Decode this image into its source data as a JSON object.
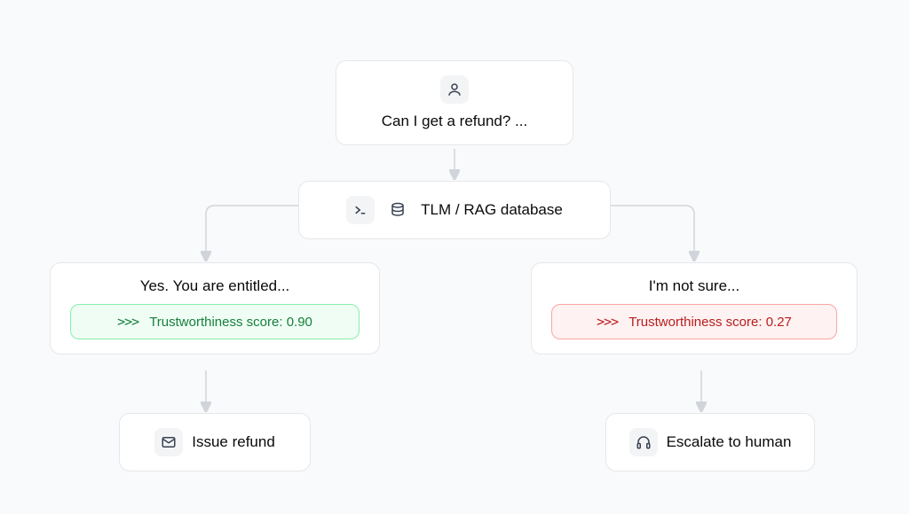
{
  "user_node": {
    "text": "Can I get a refund? ..."
  },
  "tlm_node": {
    "text": "TLM / RAG database"
  },
  "left_node": {
    "title": "Yes. You are entitled...",
    "pill_prefix": ">>>",
    "pill_label": "Trustworthiness score:",
    "pill_value": "0.90"
  },
  "right_node": {
    "title": "I'm not sure...",
    "pill_prefix": ">>>",
    "pill_label": "Trustworthiness score:",
    "pill_value": "0.27"
  },
  "issue_node": {
    "text": "Issue refund"
  },
  "escalate_node": {
    "text": "Escalate to human"
  }
}
